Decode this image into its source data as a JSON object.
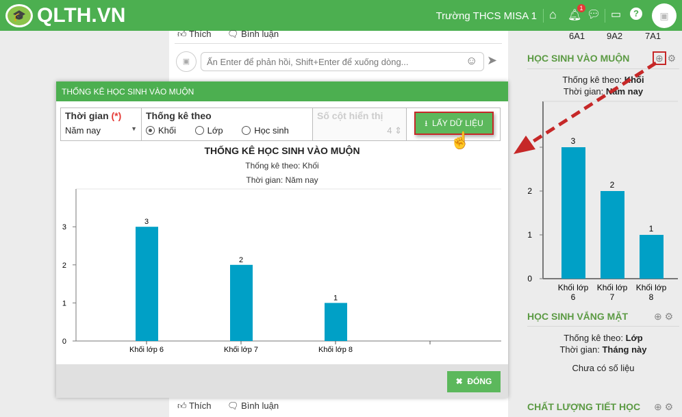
{
  "header": {
    "logo": "QLTH.VN",
    "school": "Trường THCS MISA 1",
    "notification_count": "1"
  },
  "feed": {
    "like": "Thích",
    "comment": "Bình luận",
    "reply_placeholder": "Ấn Enter để phản hồi, Shift+Enter để xuống dòng..."
  },
  "top_classes": [
    "6A1",
    "9A2",
    "7A1"
  ],
  "modal": {
    "title": "THỐNG KÊ HỌC SINH VÀO MUỘN",
    "time_label": "Thời gian",
    "required": "(*)",
    "time_value": "Năm nay",
    "group_label": "Thống kê theo",
    "options": [
      "Khối",
      "Lớp",
      "Học sinh"
    ],
    "selected": "Khối",
    "columns_label": "Số cột hiển thị",
    "columns_value": "4",
    "get_button": "LẤY DỮ LIỆU",
    "close_button": "ĐÓNG"
  },
  "chart_data": [
    {
      "type": "bar",
      "title": "THỐNG KÊ HỌC SINH VÀO MUỘN",
      "subtitle1": "Thống kê theo: Khối",
      "subtitle2": "Thời gian: Năm nay",
      "categories": [
        "Khối lớp 6",
        "Khối lớp 7",
        "Khối lớp 8",
        ""
      ],
      "values": [
        3,
        2,
        1,
        null
      ],
      "yticks": [
        "0",
        "1",
        "2",
        "3"
      ],
      "ylim": [
        0,
        3.8
      ],
      "color": "#00a0c6"
    },
    {
      "type": "bar",
      "title": "HỌC SINH VÀO MUỘN",
      "categories": [
        "Khối lớp 6",
        "Khối lớp 7",
        "Khối lớp 8"
      ],
      "values": [
        3,
        2,
        1
      ],
      "yticks": [
        "0",
        "1",
        "2",
        "3"
      ],
      "ylim": [
        0,
        4
      ],
      "color": "#00a0c6"
    }
  ],
  "right": {
    "w1": {
      "title": "HỌC SINH VÀO MUỘN",
      "by_label": "Thống kê theo: ",
      "by": "Khối",
      "time_label": "Thời gian: ",
      "time": "Năm nay"
    },
    "w2": {
      "title": "HỌC SINH VẮNG MẶT",
      "by_label": "Thống kê theo: ",
      "by": "Lớp",
      "time_label": "Thời gian: ",
      "time": "Tháng này",
      "empty": "Chưa có số liệu"
    },
    "w3": {
      "title": "CHẤT LƯỢNG TIẾT HỌC"
    }
  }
}
